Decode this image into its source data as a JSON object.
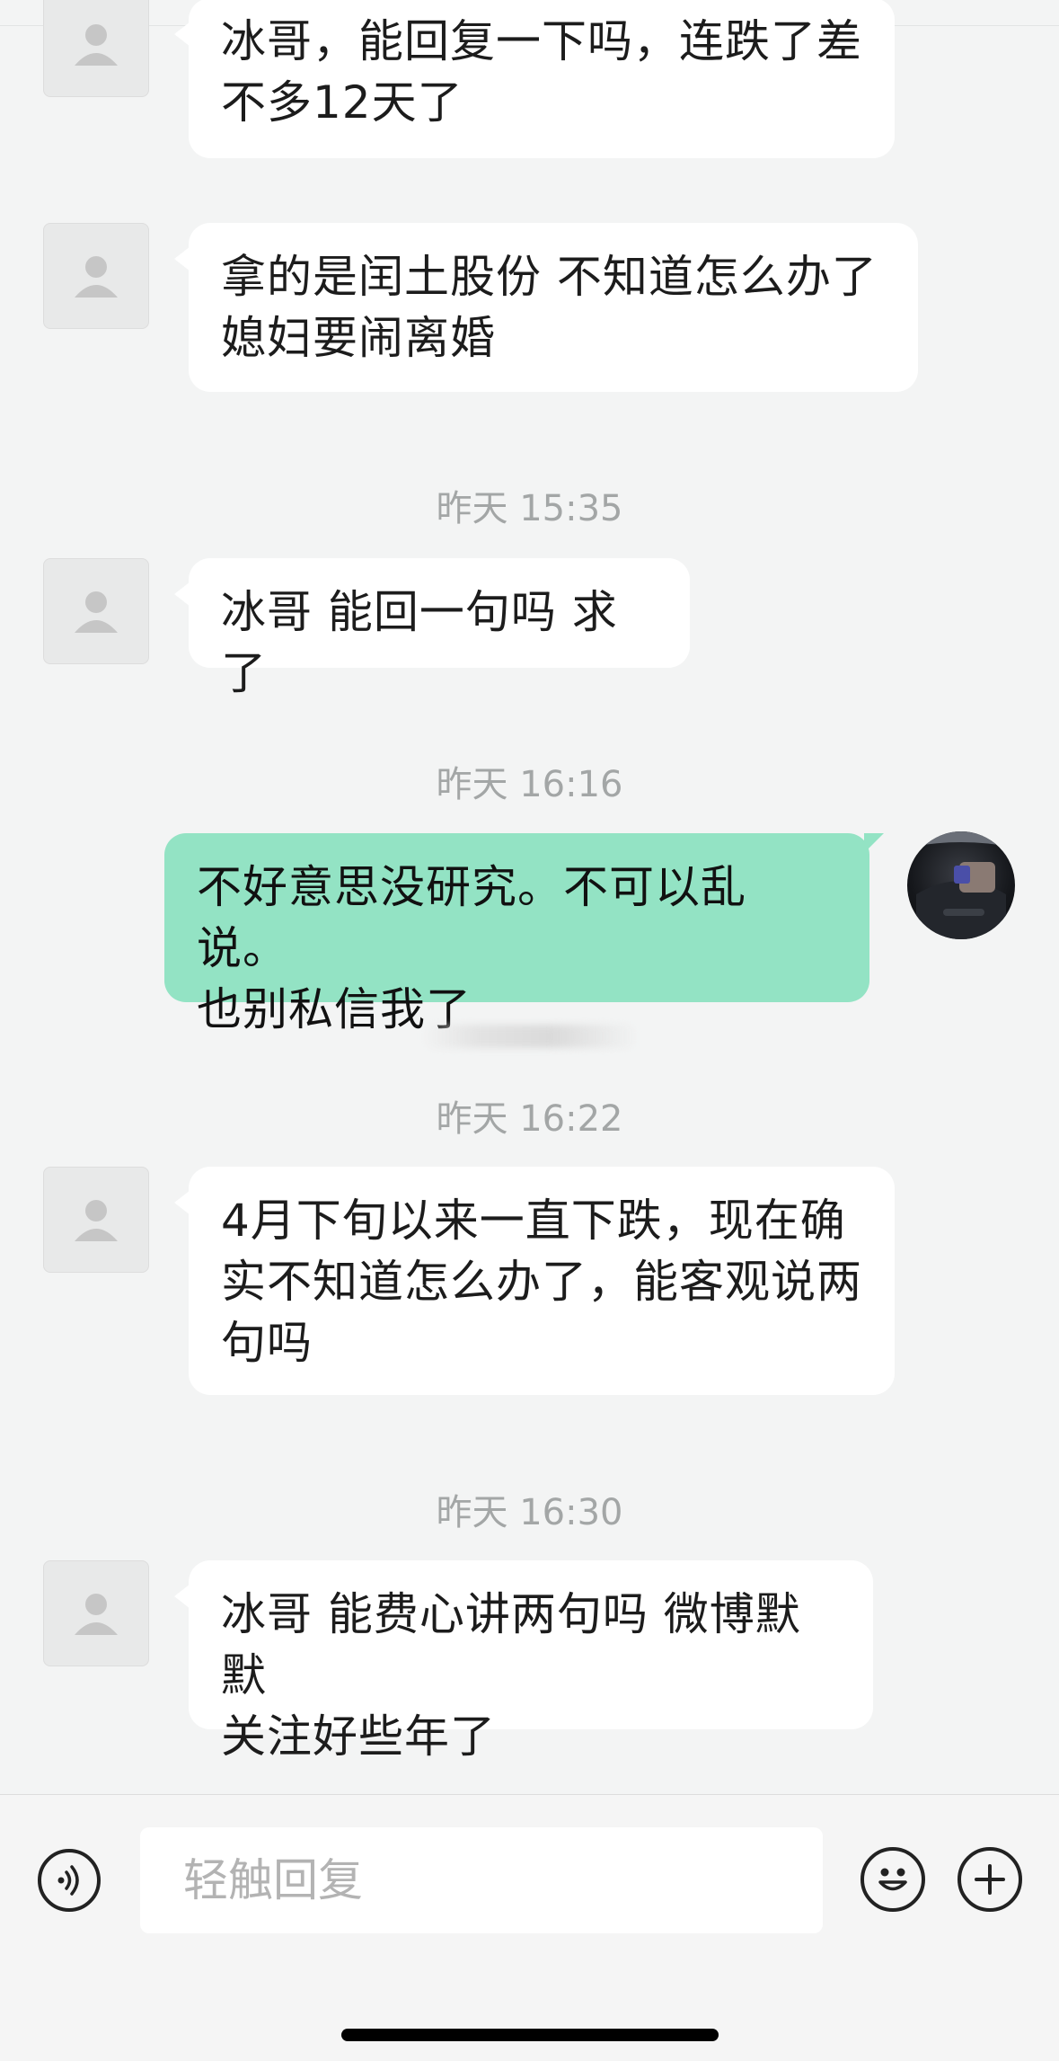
{
  "messages": [
    {
      "side": "in",
      "text_lines": [
        "冰哥，能回复一下吗，连跌了差",
        "不多12天了"
      ]
    },
    {
      "side": "in",
      "text_lines": [
        "拿的是闰土股份 不知道怎么办了",
        "媳妇要闹离婚"
      ]
    },
    {
      "side": "in",
      "text_lines": [
        "冰哥 能回一句吗 求了"
      ]
    },
    {
      "side": "out",
      "text_lines": [
        "不好意思没研究。不可以乱说。",
        "也别私信我了"
      ]
    },
    {
      "side": "in",
      "text_lines": [
        "4月下旬以来一直下跌，现在确",
        "实不知道怎么办了，能客观说两",
        "句吗"
      ]
    },
    {
      "side": "in",
      "text_lines": [
        "冰哥 能费心讲两句吗 微博默默",
        "关注好些年了"
      ]
    }
  ],
  "timestamps": [
    "昨天 15:35",
    "昨天 16:16",
    "昨天 16:22",
    "昨天 16:30"
  ],
  "input": {
    "placeholder": "轻触回复"
  },
  "icons": {
    "voice": "voice-icon",
    "emoji": "emoji-icon",
    "plus": "plus-icon",
    "avatar_placeholder": "person-icon"
  },
  "colors": {
    "outgoing_bubble": "#93e3c4",
    "incoming_bubble": "#ffffff",
    "background": "#f3f4f4"
  }
}
